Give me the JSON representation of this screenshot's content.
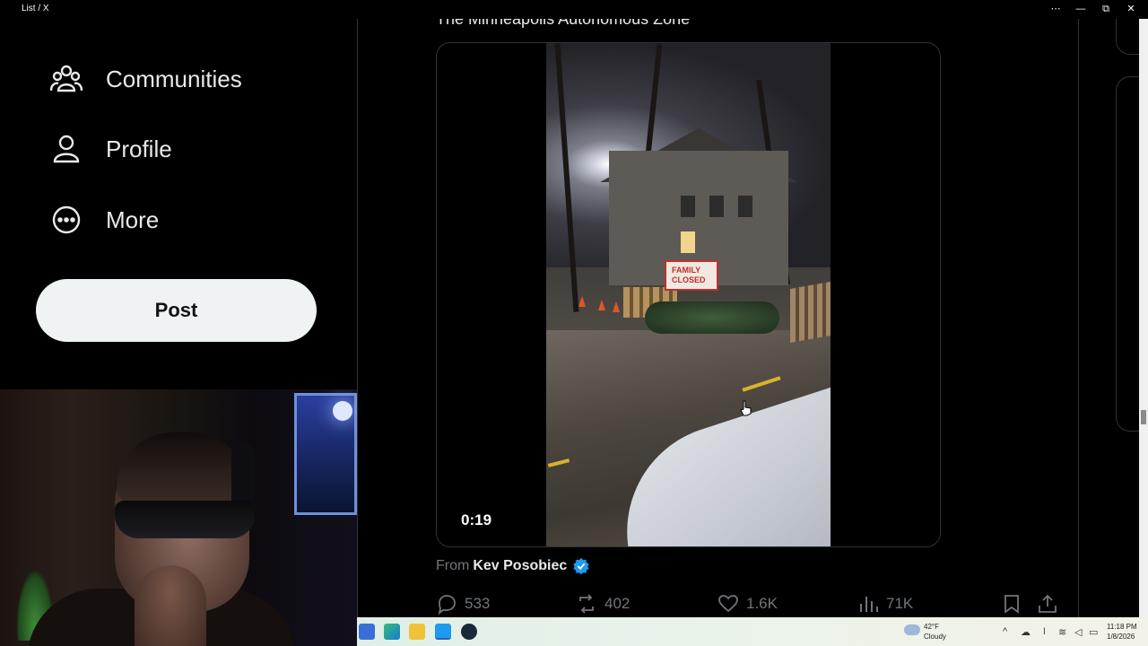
{
  "window": {
    "title": "List / X",
    "controls": [
      "⋯",
      "—",
      "⧉",
      "✕"
    ]
  },
  "sidebar": {
    "items": [
      {
        "label": "Communities",
        "icon": "communities-icon"
      },
      {
        "label": "Profile",
        "icon": "profile-icon"
      },
      {
        "label": "More",
        "icon": "more-icon"
      }
    ],
    "post_label": "Post"
  },
  "timeline": {
    "heading": "The Minneapolis Autonomous Zone",
    "video": {
      "duration": "0:19",
      "sign_text": "FAMILY CLOSED"
    },
    "from_prefix": "From",
    "author": "Kev Posobiec",
    "actions": {
      "replies": "533",
      "reposts": "402",
      "likes": "1.6K",
      "views": "71K"
    }
  },
  "taskbar": {
    "weather_temp": "42°F",
    "weather_desc": "Cloudy",
    "time": "11:18 PM",
    "date": "1/8/2026"
  },
  "colors": {
    "background": "#000000",
    "text": "#e7e9ea",
    "muted": "#71767b",
    "border": "#2f3336",
    "verified": "#1d9bf0",
    "post_button": "#eff3f4"
  }
}
